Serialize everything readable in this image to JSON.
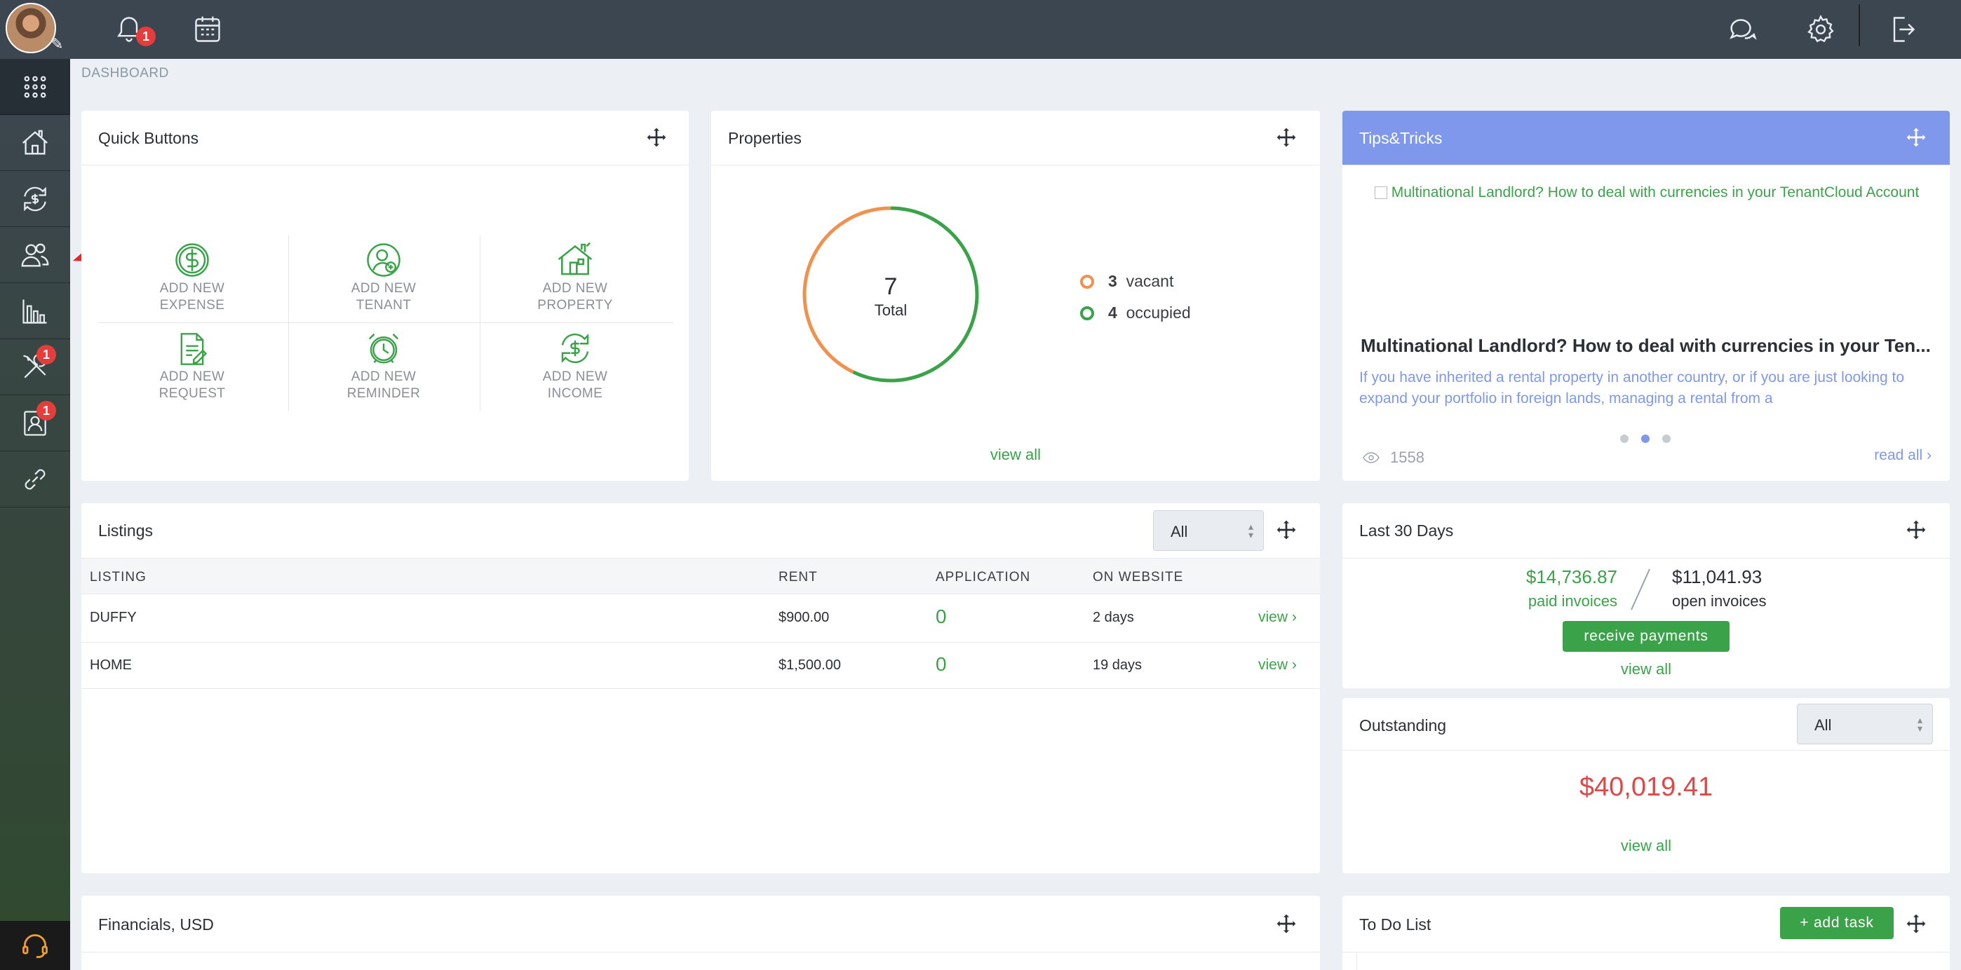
{
  "topbar": {
    "notifications_badge": "1",
    "icons": [
      "bell-icon",
      "calendar-icon",
      "chat-icon",
      "gear-icon",
      "logout-icon"
    ]
  },
  "sidebar": {
    "items": [
      {
        "name": "apps-grid-icon"
      },
      {
        "name": "properties-house-icon"
      },
      {
        "name": "transactions-exchange-icon"
      },
      {
        "name": "tenants-people-icon"
      },
      {
        "name": "reports-chart-icon"
      },
      {
        "name": "maintenance-tools-icon",
        "badge": "1"
      },
      {
        "name": "applications-icon",
        "badge": "1"
      },
      {
        "name": "links-icon"
      }
    ]
  },
  "breadcrumb": "DASHBOARD",
  "quick_buttons": {
    "title": "Quick Buttons",
    "items": [
      {
        "line1": "ADD NEW",
        "line2": "EXPENSE"
      },
      {
        "line1": "ADD NEW",
        "line2": "TENANT"
      },
      {
        "line1": "ADD NEW",
        "line2": "PROPERTY"
      },
      {
        "line1": "ADD NEW",
        "line2": "REQUEST"
      },
      {
        "line1": "ADD NEW",
        "line2": "REMINDER"
      },
      {
        "line1": "ADD NEW",
        "line2": "INCOME"
      }
    ]
  },
  "properties": {
    "title": "Properties",
    "total": "7",
    "total_label": "Total",
    "vacant_count": "3",
    "vacant_label": "vacant",
    "occupied_count": "4",
    "occupied_label": "occupied",
    "vacant_color": "#f0914f",
    "occupied_color": "#3aa34a",
    "vacant_fraction": 0.4286,
    "view_all": "view all"
  },
  "tips": {
    "title": "Tips&Tricks",
    "image_alt": "Multinational Landlord? How to deal with currencies in your TenantCloud Account",
    "headline": "Multinational Landlord? How to deal with currencies in your Ten...",
    "excerpt": "If you have inherited a rental property in another country, or if you are just looking to expand your portfolio in foreign lands, managing a rental from a",
    "views": "1558",
    "read_all": "read all ›",
    "accent": "#7f98ec"
  },
  "listings": {
    "title": "Listings",
    "filter": "All",
    "columns": [
      "LISTING",
      "RENT",
      "APPLICATION",
      "ON WEBSITE"
    ],
    "rows": [
      {
        "listing": "DUFFY",
        "rent": "$900.00",
        "application": "0",
        "on_website": "2 days",
        "action": "view ›"
      },
      {
        "listing": "HOME",
        "rent": "$1,500.00",
        "application": "0",
        "on_website": "19 days",
        "action": "view ›"
      }
    ]
  },
  "last30": {
    "title": "Last 30 Days",
    "paid_amount": "$14,736.87",
    "paid_label": "paid invoices",
    "open_amount": "$11,041.93",
    "open_label": "open invoices",
    "button": "receive payments",
    "view_all": "view all"
  },
  "outstanding": {
    "title": "Outstanding",
    "filter": "All",
    "amount": "$40,019.41",
    "amount_color": "#e04848",
    "view_all": "view all"
  },
  "financials": {
    "title": "Financials, USD"
  },
  "todo": {
    "title": "To Do List",
    "button": "+ add task"
  }
}
